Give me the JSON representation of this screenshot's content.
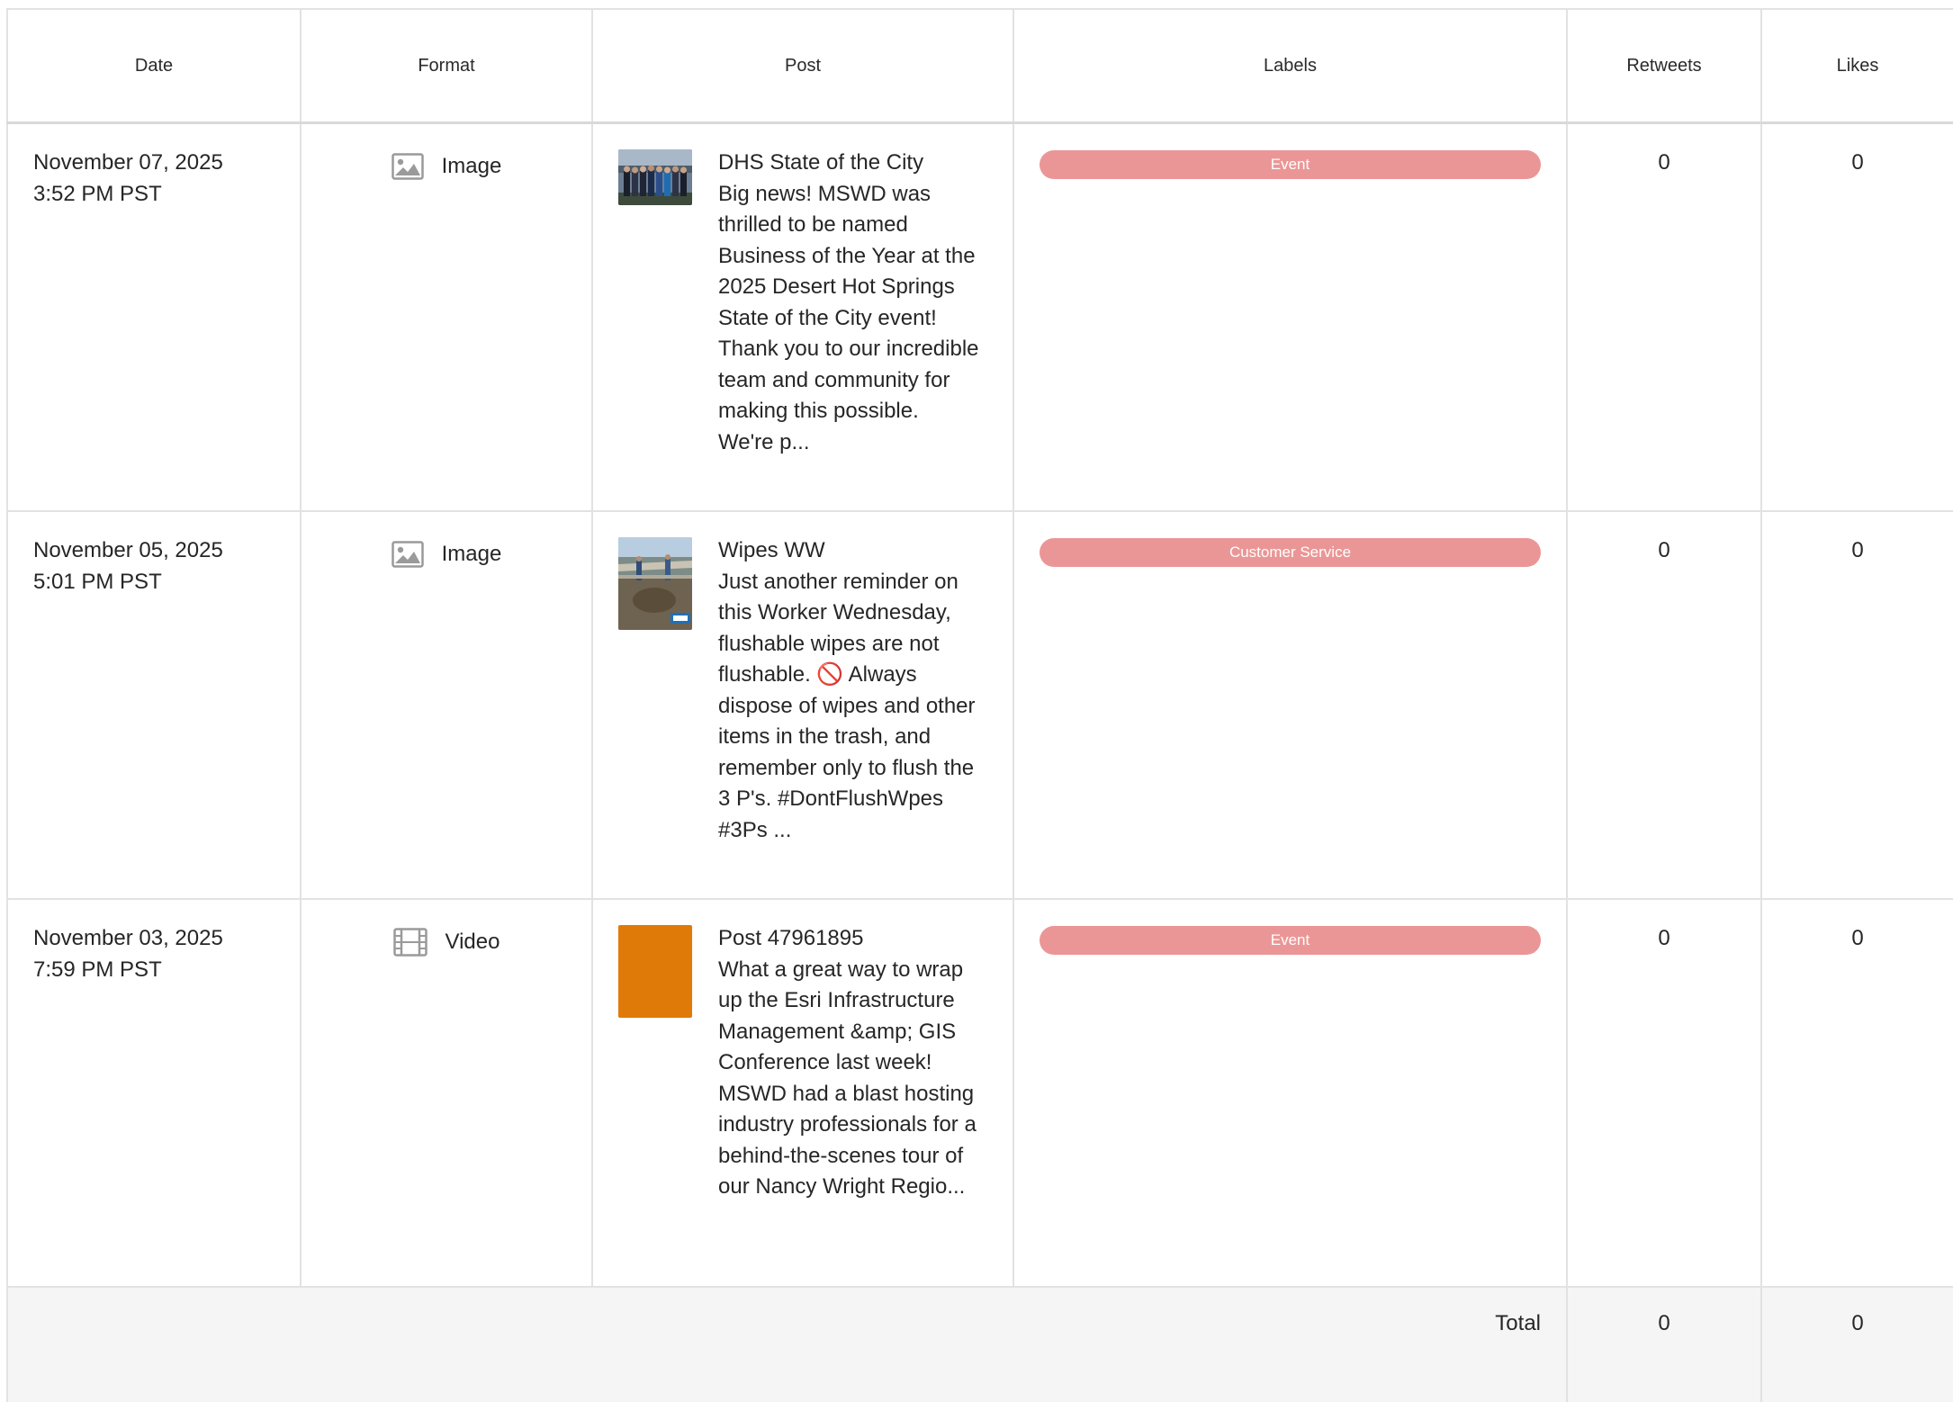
{
  "columns": {
    "date": "Date",
    "format": "Format",
    "post": "Post",
    "labels": "Labels",
    "retweets": "Retweets",
    "likes": "Likes"
  },
  "rows": [
    {
      "date": "November 07, 2025",
      "time": "3:52 PM PST",
      "format_icon": "image-icon",
      "format": "Image",
      "thumbnail": "group-photo-thumbnail",
      "post_title": "DHS State of the City",
      "post_body": "Big news! MSWD was thrilled to be named Business of the Year at the 2025 Desert Hot Springs State of the City event! Thank you to our incredible team and community for making this possible. We're p...",
      "label": "Event",
      "label_color": "#eb9696",
      "retweets": "0",
      "likes": "0"
    },
    {
      "date": "November 05, 2025",
      "time": "5:01 PM PST",
      "format_icon": "image-icon",
      "format": "Image",
      "thumbnail": "worksite-photo-thumbnail",
      "post_title": "Wipes WW",
      "post_body_a": "Just another reminder on this Worker Wednesday, flushable wipes are not flushable. ",
      "post_body_emoji": "🚫",
      "post_body_b": " Always dispose of wipes and other items in the trash, and remember only to flush the 3 P's. #DontFlushWpes #3Ps ...",
      "label": "Customer Service",
      "label_color": "#eb9696",
      "retweets": "0",
      "likes": "0"
    },
    {
      "date": "November 03, 2025",
      "time": "7:59 PM PST",
      "format_icon": "film-icon",
      "format": "Video",
      "thumbnail": "video-placeholder-thumbnail",
      "thumbnail_color": "#df7a08",
      "post_title": "Post 47961895",
      "post_body": "What a great way to wrap up the Esri Infrastructure Management &amp; GIS Conference last week! MSWD had a blast hosting industry professionals for a behind-the-scenes tour of our Nancy Wright Regio...",
      "label": "Event",
      "label_color": "#eb9696",
      "retweets": "0",
      "likes": "0"
    }
  ],
  "footer": {
    "total_label": "Total",
    "retweets_total": "0",
    "likes_total": "0"
  },
  "colors": {
    "border": "#e2e2e2",
    "footer_bg": "#f5f5f5",
    "label_pill": "#eb9696",
    "icon_gray": "#9a9a9a"
  }
}
